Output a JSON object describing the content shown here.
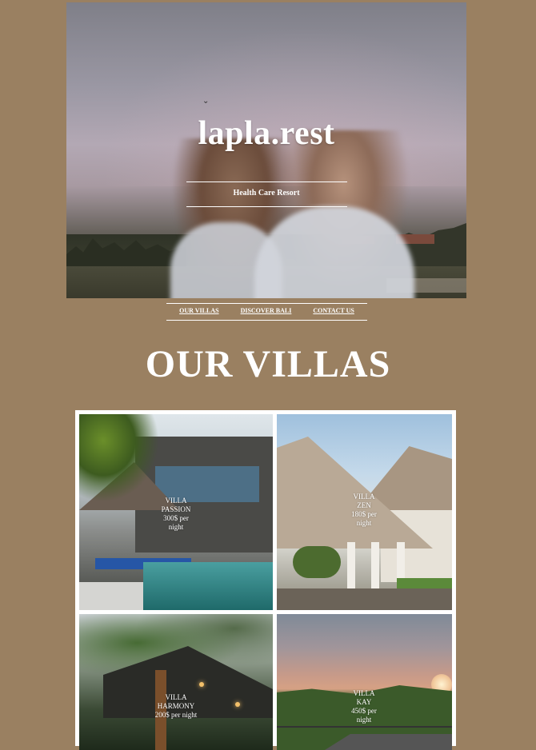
{
  "hero": {
    "title": "lapla.rest",
    "subtitle": "Health Care Resort"
  },
  "nav": {
    "items": [
      {
        "label": "OUR VILLAS"
      },
      {
        "label": "DISCOVER BALI"
      },
      {
        "label": "CONTACT US"
      }
    ]
  },
  "villas_section": {
    "title": "OUR VILLAS",
    "villas": [
      {
        "name": "VILLA PASSION",
        "price": "300$ per night"
      },
      {
        "name": "VILLA ZEN",
        "price": "180$ per night"
      },
      {
        "name": "VILLA HARMONY",
        "price": "200$ per night"
      },
      {
        "name": "VILLA KAY",
        "price": "450$ per night"
      }
    ]
  }
}
